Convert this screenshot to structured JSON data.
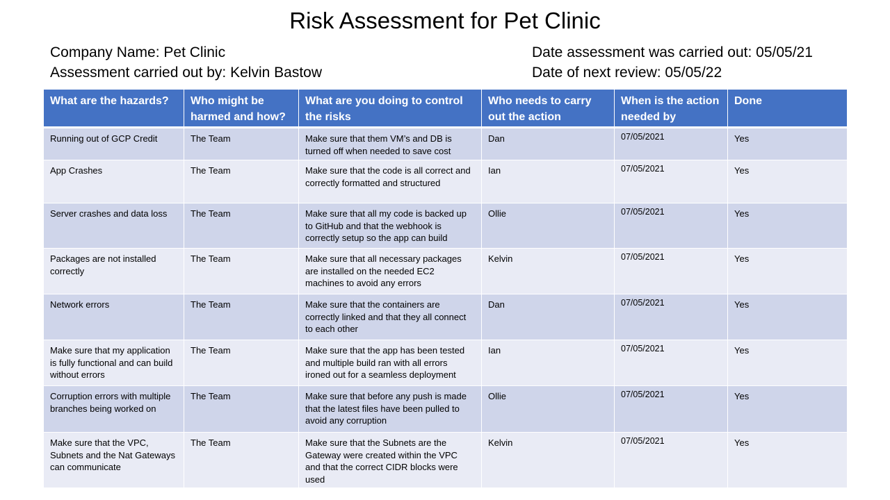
{
  "title": "Risk Assessment for Pet Clinic",
  "company_name": "Company Name: Pet Clinic",
  "assessor": "Assessment carried out by: Kelvin Bastow",
  "date_carried_out": "Date assessment was carried out: 05/05/21",
  "date_next_review": "Date of next review: 05/05/22",
  "table": {
    "headers": [
      "What are the hazards?",
      "Who might be harmed and how?",
      "What are you doing to control the risks",
      "Who needs to carry out the action",
      "When is the action needed by",
      "Done"
    ],
    "rows": [
      [
        "Running out of GCP Credit",
        "The Team",
        "Make sure that them VM’s and DB is turned off when needed to save cost",
        "Dan",
        "07/05/2021",
        "Yes"
      ],
      [
        "App Crashes",
        "The Team",
        "Make sure that the code is all correct and correctly formatted and structured",
        "Ian",
        "07/05/2021",
        "Yes"
      ],
      [
        "Server crashes and data loss",
        "The Team",
        "Make sure that all my code is backed up to GitHub and that the webhook is correctly setup so the app can build",
        "Ollie",
        "07/05/2021",
        "Yes"
      ],
      [
        "Packages are not installed correctly",
        "The Team",
        "Make sure that all necessary packages are installed on the needed EC2 machines to avoid any errors",
        "Kelvin",
        "07/05/2021",
        "Yes"
      ],
      [
        "Network errors",
        "The Team",
        "Make sure that the containers are correctly linked and that they all connect to each other",
        "Dan",
        "07/05/2021",
        "Yes"
      ],
      [
        "Make sure that my application is fully functional and can build without errors",
        "The Team",
        "Make sure that the app has been tested and multiple build ran with all errors ironed out for a  seamless deployment",
        "Ian",
        "07/05/2021",
        "Yes"
      ],
      [
        "Corruption errors with multiple branches being worked on",
        "The Team",
        "Make sure that before any push is made that the latest files have been pulled to avoid any corruption",
        "Ollie",
        "07/05/2021",
        "Yes"
      ],
      [
        "Make sure that the VPC, Subnets and the Nat Gateways can communicate",
        "The Team",
        "Make sure that the Subnets are the Gateway were created within the VPC and that the correct CIDR blocks were used",
        "Kelvin",
        "07/05/2021",
        "Yes"
      ]
    ]
  }
}
